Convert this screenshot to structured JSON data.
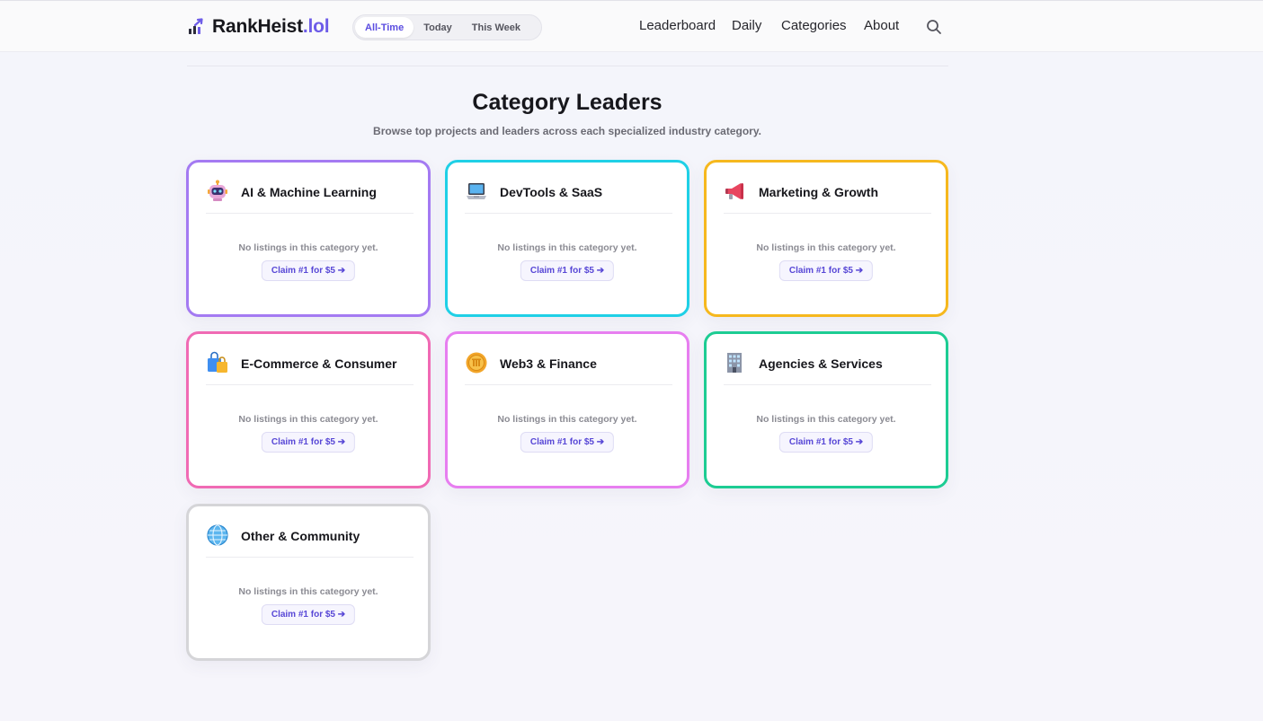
{
  "header": {
    "brand_name": "RankHeist",
    "brand_tld": ".lol",
    "logo_icon": "chart-arrow-up-icon",
    "time_filters": [
      {
        "label": "All-Time",
        "active": true
      },
      {
        "label": "Today",
        "active": false
      },
      {
        "label": "This Week",
        "active": false
      }
    ],
    "nav": [
      "Leaderboard",
      "Daily",
      "Categories",
      "About"
    ],
    "search_icon": "search-icon"
  },
  "main": {
    "title": "Category Leaders",
    "subtitle": "Browse top projects and leaders across each specialized industry category."
  },
  "categories": [
    {
      "title": "AI & Machine Learning",
      "icon": "robot-icon",
      "border_color": "#a47af2",
      "empty_text": "No listings in this category yet.",
      "claim_label": "Claim #1 for $5 ➔"
    },
    {
      "title": "DevTools & SaaS",
      "icon": "laptop-icon",
      "border_color": "#1fd0e6",
      "empty_text": "No listings in this category yet.",
      "claim_label": "Claim #1 for $5 ➔"
    },
    {
      "title": "Marketing & Growth",
      "icon": "megaphone-icon",
      "border_color": "#f6b81e",
      "empty_text": "No listings in this category yet.",
      "claim_label": "Claim #1 for $5 ➔"
    },
    {
      "title": "E-Commerce & Consumer",
      "icon": "shopping-bags-icon",
      "border_color": "#f06ab4",
      "empty_text": "No listings in this category yet.",
      "claim_label": "Claim #1 for $5 ➔"
    },
    {
      "title": "Web3 & Finance",
      "icon": "coin-icon",
      "border_color": "#e77ef0",
      "empty_text": "No listings in this category yet.",
      "claim_label": "Claim #1 for $5 ➔"
    },
    {
      "title": "Agencies & Services",
      "icon": "office-building-icon",
      "border_color": "#1dcc93",
      "empty_text": "No listings in this category yet.",
      "claim_label": "Claim #1 for $5 ➔"
    },
    {
      "title": "Other & Community",
      "icon": "globe-icon",
      "border_color": "#d5d5d8",
      "empty_text": "No listings in this category yet.",
      "claim_label": "Claim #1 for $5 ➔"
    }
  ]
}
